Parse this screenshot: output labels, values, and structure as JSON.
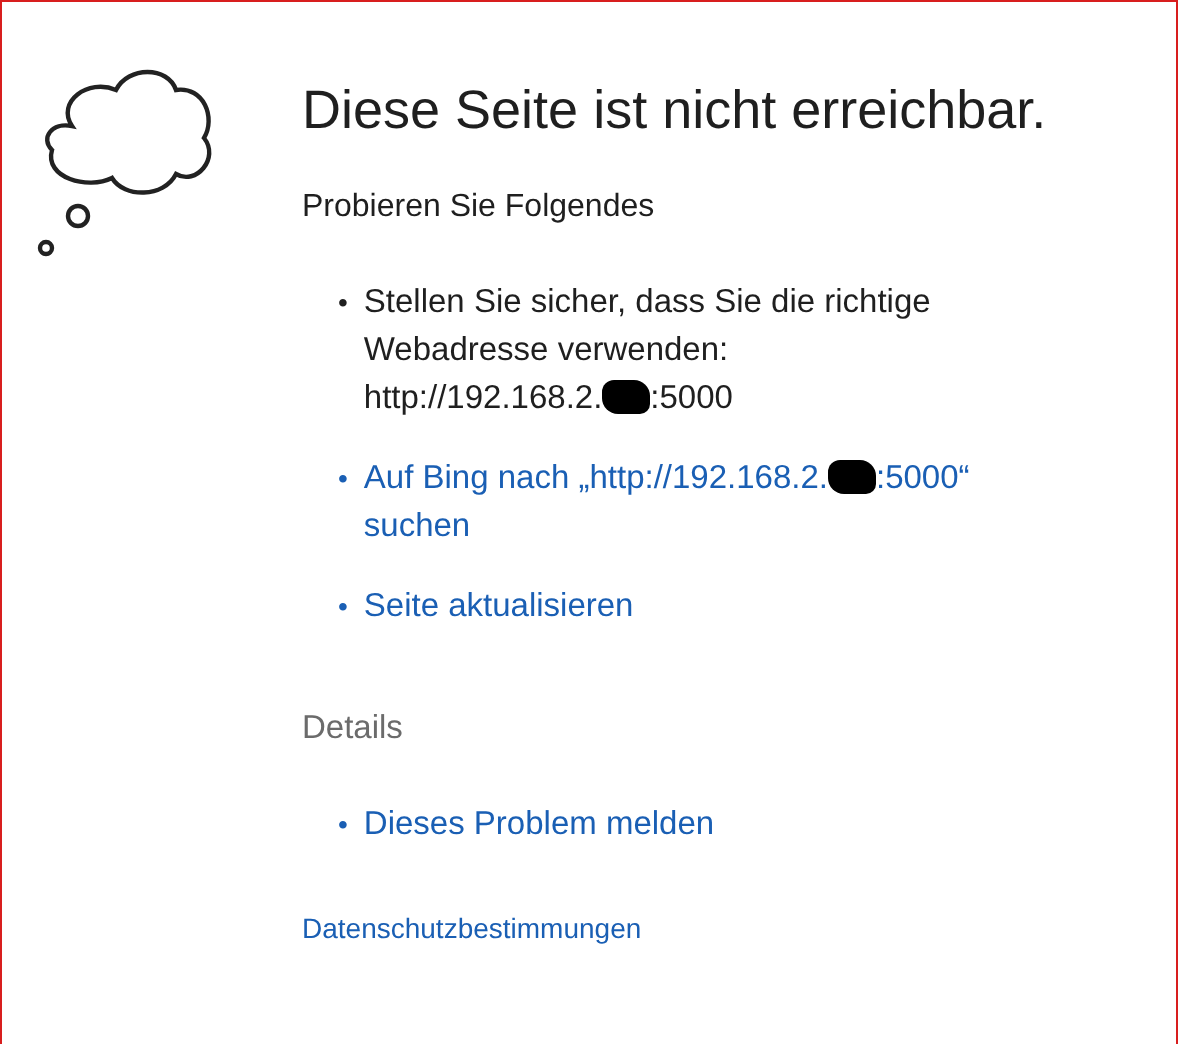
{
  "title": "Diese Seite ist nicht erreichbar.",
  "subtitle": "Probieren Sie Folgendes",
  "suggestions": [
    {
      "kind": "plain",
      "bullet": "•",
      "lines": [
        [
          {
            "kind": "text",
            "text": "Stellen Sie sicher, dass Sie die richtige"
          }
        ],
        [
          {
            "kind": "text",
            "text": "Webadresse verwenden:"
          }
        ],
        [
          {
            "kind": "text",
            "text": "http://192.168.2."
          },
          {
            "kind": "redacted"
          },
          {
            "kind": "text",
            "text": ":5000"
          }
        ]
      ]
    },
    {
      "kind": "link",
      "bullet": "•",
      "lines": [
        [
          {
            "kind": "text",
            "text": "Auf Bing nach „http://192.168.2."
          },
          {
            "kind": "redacted"
          },
          {
            "kind": "text",
            "text": ":5000“"
          }
        ],
        [
          {
            "kind": "text",
            "text": "suchen"
          }
        ]
      ]
    },
    {
      "kind": "link",
      "bullet": "•",
      "lines": [
        [
          {
            "kind": "text",
            "text": "Seite aktualisieren"
          }
        ]
      ]
    }
  ],
  "details": {
    "heading": "Details",
    "items": [
      {
        "kind": "link",
        "bullet": "•",
        "lines": [
          [
            {
              "kind": "text",
              "text": "Dieses Problem melden"
            }
          ]
        ]
      }
    ]
  },
  "footer_link": "Datenschutzbestimmungen"
}
